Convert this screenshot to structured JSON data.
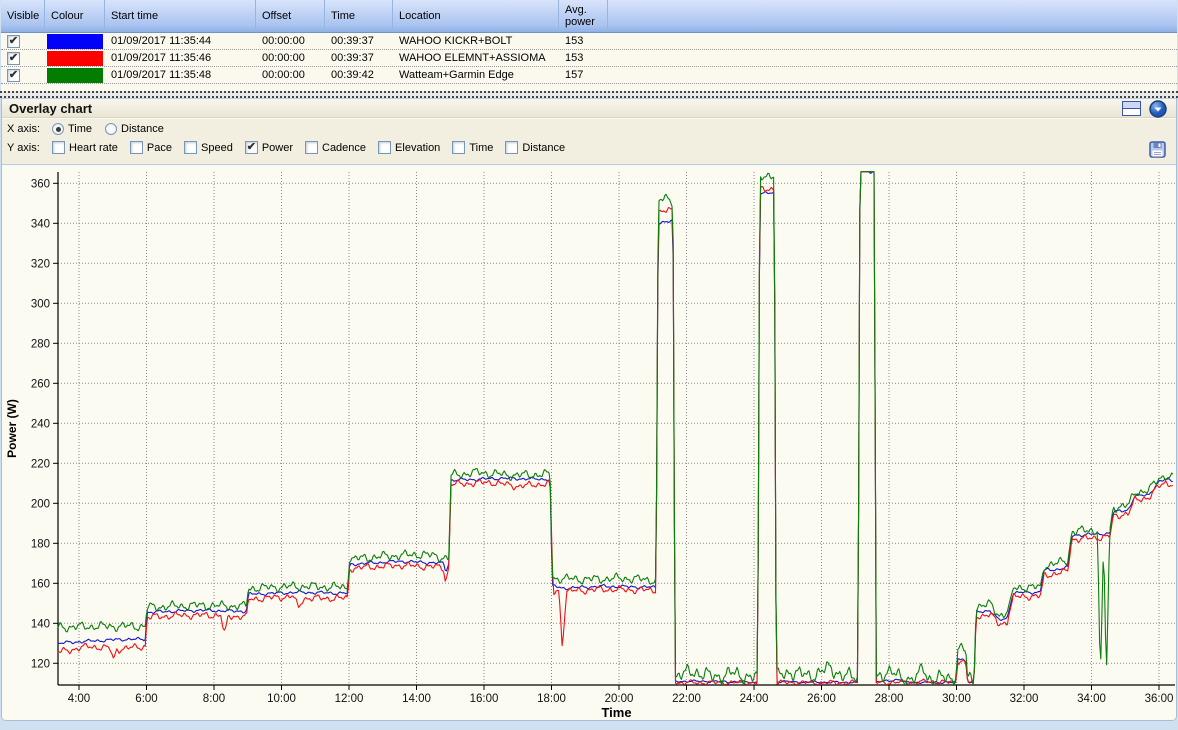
{
  "table": {
    "columns": [
      "Visible",
      "Colour",
      "Start time",
      "Offset",
      "Time",
      "Location",
      "Avg.\npower"
    ],
    "rows": [
      {
        "visible": true,
        "colour": "#0202fa",
        "start_time": "01/09/2017 11:35:44",
        "offset": "00:00:00",
        "time": "00:39:37",
        "location": "WAHOO KICKR+BOLT",
        "avg_power": "153"
      },
      {
        "visible": true,
        "colour": "#fb0200",
        "start_time": "01/09/2017 11:35:46",
        "offset": "00:00:00",
        "time": "00:39:37",
        "location": "WAHOO ELEMNT+ASSIOMA",
        "avg_power": "153"
      },
      {
        "visible": true,
        "colour": "#027d02",
        "start_time": "01/09/2017 11:35:48",
        "offset": "00:00:00",
        "time": "00:39:42",
        "location": "Watteam+Garmin Edge",
        "avg_power": "157"
      }
    ]
  },
  "panel": {
    "title": "Overlay chart",
    "x_axis_label": "X axis:",
    "x_options": [
      {
        "label": "Time",
        "selected": true
      },
      {
        "label": "Distance",
        "selected": false
      }
    ],
    "y_axis_label": "Y axis:",
    "y_options": [
      {
        "label": "Heart rate",
        "checked": false
      },
      {
        "label": "Pace",
        "checked": false
      },
      {
        "label": "Speed",
        "checked": false
      },
      {
        "label": "Power",
        "checked": true
      },
      {
        "label": "Cadence",
        "checked": false
      },
      {
        "label": "Elevation",
        "checked": false
      },
      {
        "label": "Time",
        "checked": false
      },
      {
        "label": "Distance",
        "checked": false
      }
    ],
    "icons": [
      "split-layout-icon",
      "collapse-circle-icon",
      "save-icon"
    ]
  },
  "chart_data": {
    "type": "line",
    "xlabel": "Time",
    "ylabel": "Power (W)",
    "x_tick_minutes": [
      4,
      6,
      8,
      10,
      12,
      14,
      16,
      18,
      20,
      22,
      24,
      26,
      28,
      30,
      32,
      34,
      36
    ],
    "x_tick_labels": [
      "4:00",
      "6:00",
      "8:00",
      "10:00",
      "12:00",
      "14:00",
      "16:00",
      "18:00",
      "20:00",
      "22:00",
      "24:00",
      "26:00",
      "28:00",
      "30:00",
      "32:00",
      "34:00",
      "36:00"
    ],
    "y_ticks": [
      120,
      140,
      160,
      180,
      200,
      220,
      240,
      260,
      280,
      300,
      320,
      340,
      360
    ],
    "xlim_minutes": [
      3.37,
      36.45
    ],
    "ylim": [
      109.4,
      365.8
    ],
    "grid": true,
    "legend": "none",
    "series": [
      {
        "name": "WAHOO KICKR+BOLT",
        "color": "#1515cd",
        "noise": 0.8,
        "points": [
          [
            3.37,
            130
          ],
          [
            4.2,
            131
          ],
          [
            5.3,
            132
          ],
          [
            5.96,
            132
          ],
          [
            6.02,
            145.5
          ],
          [
            7.5,
            146.5
          ],
          [
            8.96,
            146
          ],
          [
            9.02,
            154.5
          ],
          [
            10.5,
            155.5
          ],
          [
            11.96,
            155
          ],
          [
            12.02,
            169.5
          ],
          [
            13.5,
            171
          ],
          [
            14.8,
            170
          ],
          [
            14.87,
            166
          ],
          [
            14.96,
            170
          ],
          [
            15.02,
            211.5
          ],
          [
            16.5,
            212.5
          ],
          [
            17.96,
            212
          ],
          [
            18.02,
            159
          ],
          [
            18.3,
            157.5
          ],
          [
            19.5,
            158.5
          ],
          [
            21.1,
            158
          ],
          [
            21.16,
            340.5
          ],
          [
            21.6,
            341
          ],
          [
            21.66,
            111
          ],
          [
            22.5,
            111
          ],
          [
            24.11,
            110.5
          ],
          [
            24.17,
            354.5
          ],
          [
            24.6,
            355.5
          ],
          [
            24.66,
            111
          ],
          [
            25.5,
            110.5
          ],
          [
            27.08,
            110.5
          ],
          [
            27.14,
            366
          ],
          [
            27.56,
            366
          ],
          [
            27.62,
            110.5
          ],
          [
            28.3,
            112
          ],
          [
            28.45,
            110.5
          ],
          [
            29.98,
            110.5
          ],
          [
            30.04,
            122
          ],
          [
            30.16,
            123
          ],
          [
            30.28,
            121
          ],
          [
            30.33,
            110.5
          ],
          [
            30.52,
            110.5
          ],
          [
            30.58,
            145.5
          ],
          [
            31.0,
            146.5
          ],
          [
            31.25,
            141.5
          ],
          [
            31.5,
            142.5
          ],
          [
            31.68,
            155
          ],
          [
            32.0,
            155.5
          ],
          [
            32.48,
            155.5
          ],
          [
            32.6,
            166.5
          ],
          [
            33.0,
            167
          ],
          [
            33.3,
            168
          ],
          [
            33.42,
            184
          ],
          [
            34.0,
            184.5
          ],
          [
            34.55,
            185
          ],
          [
            34.64,
            195.5
          ],
          [
            35.1,
            197
          ],
          [
            35.28,
            203.5
          ],
          [
            35.7,
            204.5
          ],
          [
            36.0,
            210.5
          ],
          [
            36.2,
            212
          ],
          [
            36.42,
            211.5
          ]
        ]
      },
      {
        "name": "WAHOO ELEMNT+ASSIOMA",
        "color": "#ef1014",
        "noise": 1.7,
        "points": [
          [
            3.37,
            125.5
          ],
          [
            4.3,
            128.5
          ],
          [
            4.92,
            127.5
          ],
          [
            5.02,
            121.5
          ],
          [
            5.12,
            127
          ],
          [
            5.96,
            128.5
          ],
          [
            6.02,
            143
          ],
          [
            7.0,
            144
          ],
          [
            8.2,
            144
          ],
          [
            8.3,
            134.5
          ],
          [
            8.42,
            143.5
          ],
          [
            8.96,
            143.5
          ],
          [
            9.02,
            152
          ],
          [
            10.35,
            153.5
          ],
          [
            10.5,
            147.5
          ],
          [
            10.65,
            152.5
          ],
          [
            11.96,
            152.5
          ],
          [
            12.02,
            167.5
          ],
          [
            13.5,
            169
          ],
          [
            14.78,
            168
          ],
          [
            14.86,
            161
          ],
          [
            14.96,
            168
          ],
          [
            15.02,
            209.5
          ],
          [
            16.2,
            210.5
          ],
          [
            17.0,
            208.5
          ],
          [
            17.96,
            210
          ],
          [
            18.05,
            155
          ],
          [
            18.22,
            156.5
          ],
          [
            18.32,
            127.5
          ],
          [
            18.45,
            156
          ],
          [
            19.5,
            157
          ],
          [
            21.1,
            156.5
          ],
          [
            21.16,
            345.5
          ],
          [
            21.6,
            346.5
          ],
          [
            21.66,
            110.3
          ],
          [
            24.11,
            110.3
          ],
          [
            24.17,
            356.5
          ],
          [
            24.6,
            357.5
          ],
          [
            24.66,
            110.3
          ],
          [
            27.08,
            110.3
          ],
          [
            27.14,
            368
          ],
          [
            27.56,
            368
          ],
          [
            27.62,
            110.3
          ],
          [
            29.3,
            110.8
          ],
          [
            29.98,
            110.3
          ],
          [
            30.04,
            120.5
          ],
          [
            30.16,
            121.5
          ],
          [
            30.28,
            119.5
          ],
          [
            30.33,
            110.3
          ],
          [
            30.52,
            110.3
          ],
          [
            30.58,
            143.5
          ],
          [
            31.0,
            144.5
          ],
          [
            31.25,
            139.5
          ],
          [
            31.5,
            140.5
          ],
          [
            31.68,
            153
          ],
          [
            32.0,
            153.5
          ],
          [
            32.48,
            153.5
          ],
          [
            32.6,
            164
          ],
          [
            33.0,
            165
          ],
          [
            33.3,
            166
          ],
          [
            33.42,
            182
          ],
          [
            34.0,
            182.5
          ],
          [
            34.55,
            183.5
          ],
          [
            34.64,
            193.5
          ],
          [
            35.1,
            195
          ],
          [
            35.28,
            201.5
          ],
          [
            35.7,
            203
          ],
          [
            36.0,
            208.5
          ],
          [
            36.2,
            210.5
          ],
          [
            36.42,
            209.5
          ]
        ]
      },
      {
        "name": "Watteam+Garmin Edge",
        "color": "#0b7e0b",
        "noise": 2.2,
        "points": [
          [
            3.37,
            138
          ],
          [
            4.5,
            138.5
          ],
          [
            5.96,
            138.5
          ],
          [
            6.02,
            148
          ],
          [
            7.5,
            149
          ],
          [
            8.96,
            148.5
          ],
          [
            9.02,
            157.5
          ],
          [
            10.5,
            158.5
          ],
          [
            11.96,
            158
          ],
          [
            12.02,
            172
          ],
          [
            13.0,
            173.5
          ],
          [
            14.2,
            174.5
          ],
          [
            14.96,
            172.5
          ],
          [
            15.02,
            214
          ],
          [
            15.8,
            215.5
          ],
          [
            16.8,
            214
          ],
          [
            17.96,
            214.5
          ],
          [
            18.02,
            162.5
          ],
          [
            19.0,
            162
          ],
          [
            20.2,
            162.5
          ],
          [
            21.1,
            161.5
          ],
          [
            21.16,
            351
          ],
          [
            21.4,
            352.5
          ],
          [
            21.6,
            351
          ],
          [
            21.66,
            113.5
          ],
          [
            22.25,
            116
          ],
          [
            22.8,
            113
          ],
          [
            23.3,
            115
          ],
          [
            24.11,
            112.5
          ],
          [
            24.17,
            363
          ],
          [
            24.4,
            364.5
          ],
          [
            24.6,
            363.5
          ],
          [
            24.66,
            113
          ],
          [
            25.1,
            116
          ],
          [
            25.6,
            113.5
          ],
          [
            26.25,
            117.5
          ],
          [
            26.7,
            113.5
          ],
          [
            27.08,
            113
          ],
          [
            27.14,
            369
          ],
          [
            27.56,
            369
          ],
          [
            27.62,
            112.5
          ],
          [
            27.95,
            116.5
          ],
          [
            28.35,
            112.5
          ],
          [
            28.85,
            112.5
          ],
          [
            29.0,
            118.5
          ],
          [
            29.15,
            112.5
          ],
          [
            29.98,
            112.5
          ],
          [
            30.04,
            127
          ],
          [
            30.16,
            128.5
          ],
          [
            30.28,
            125.5
          ],
          [
            30.33,
            112
          ],
          [
            30.52,
            112
          ],
          [
            30.58,
            148.5
          ],
          [
            31.0,
            149.5
          ],
          [
            31.25,
            144
          ],
          [
            31.5,
            145.5
          ],
          [
            31.68,
            157.5
          ],
          [
            32.0,
            158
          ],
          [
            32.48,
            158
          ],
          [
            32.6,
            169
          ],
          [
            33.0,
            170
          ],
          [
            33.3,
            171.5
          ],
          [
            33.42,
            186
          ],
          [
            34.0,
            186.5
          ],
          [
            34.18,
            186
          ],
          [
            34.26,
            111.5
          ],
          [
            34.36,
            181
          ],
          [
            34.44,
            112
          ],
          [
            34.54,
            186
          ],
          [
            34.64,
            198
          ],
          [
            35.1,
            199
          ],
          [
            35.28,
            205.5
          ],
          [
            35.7,
            206.5
          ],
          [
            36.0,
            212.5
          ],
          [
            36.2,
            214
          ],
          [
            36.42,
            212.5
          ]
        ]
      }
    ]
  }
}
